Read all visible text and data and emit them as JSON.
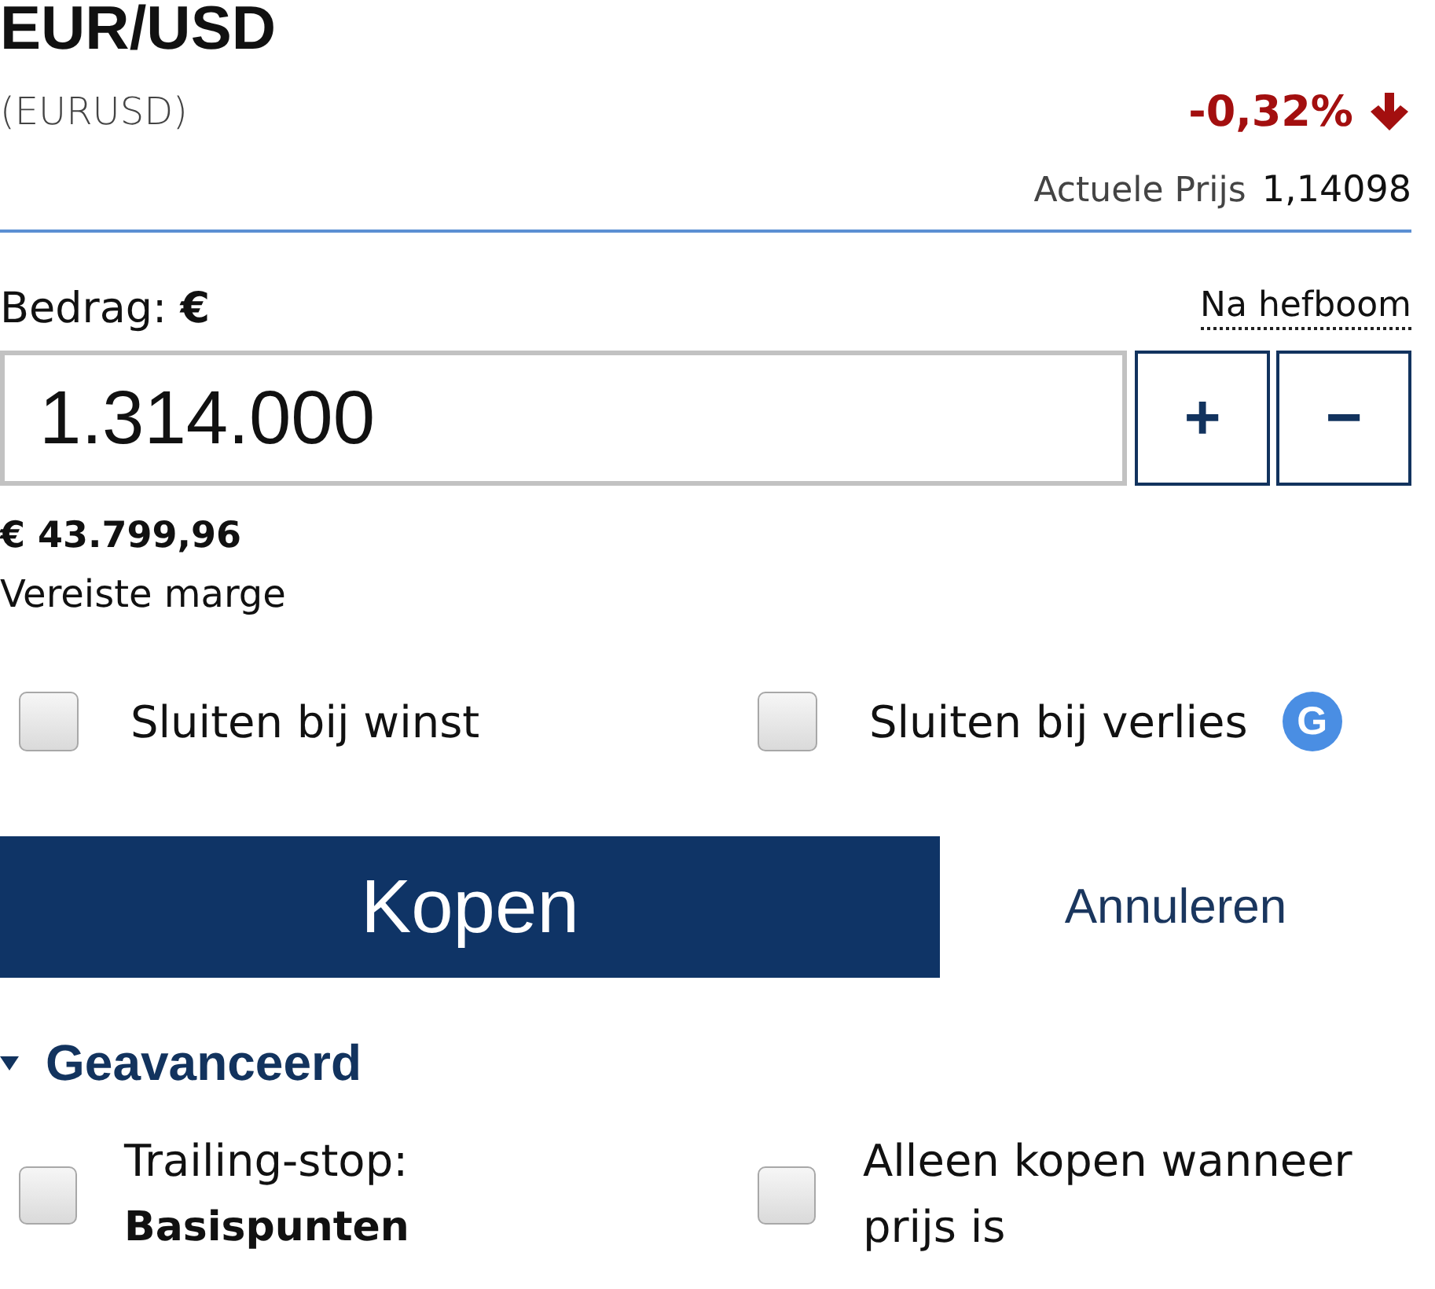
{
  "instrument": {
    "title": "EUR/USD",
    "symbol": "(EURUSD)",
    "change": "-0,32%",
    "falling": true,
    "price_label": "Actuele Prijs",
    "price": "1,14098"
  },
  "amount": {
    "label": "Bedrag: **€**",
    "leverage_link": "Na hefboom",
    "value": "1.314.000",
    "buttons": [
      "+",
      "−"
    ]
  },
  "margin": {
    "value": "€ 43.799,96",
    "label": "Vereiste marge"
  },
  "options": [
    {
      "label": "Sluiten bij winst",
      "checked": false
    },
    {
      "label": "Sluiten bij verlies",
      "checked": false,
      "badge": "G"
    }
  ],
  "actions": {
    "primary": "Kopen",
    "secondary": "Annuleren"
  },
  "advanced": {
    "label": "Geavanceerd",
    "expanded": true,
    "options": [
      {
        "label": "Trailing-stop:",
        "detail": "Basispunten",
        "checked": false
      },
      {
        "label": "Alleen kopen wanneer prijs is",
        "checked": false
      }
    ]
  }
}
